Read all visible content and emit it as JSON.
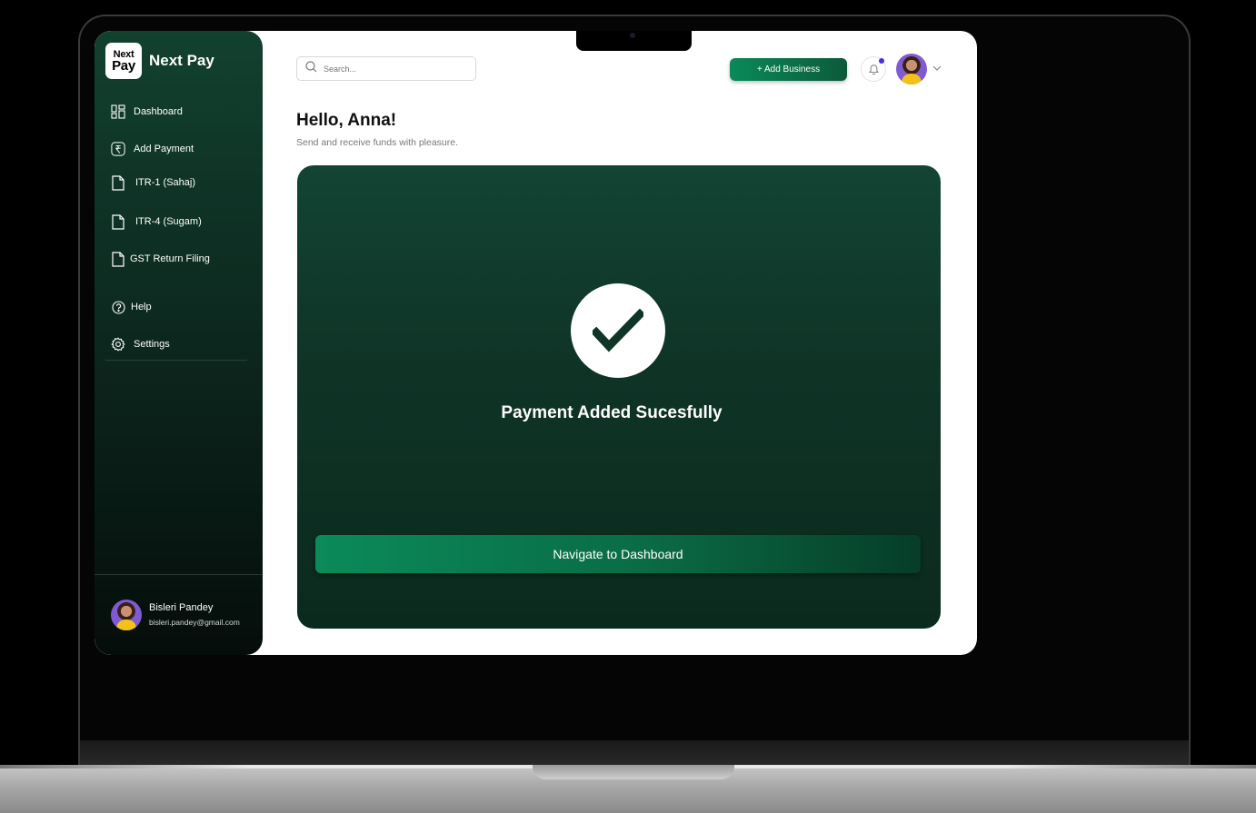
{
  "app": {
    "logo_line1": "Next",
    "logo_line2": "Pay",
    "name": "Next Pay"
  },
  "sidebar": {
    "items": [
      {
        "label": "Dashboard",
        "icon": "dashboard-icon"
      },
      {
        "label": "Add Payment",
        "icon": "rupee-icon"
      },
      {
        "label": "ITR-1 (Sahaj)",
        "icon": "document-icon"
      },
      {
        "label": "ITR-4 (Sugam)",
        "icon": "document-icon"
      },
      {
        "label": "GST Return Filing",
        "icon": "document-icon"
      },
      {
        "label": "Help",
        "icon": "help-icon"
      },
      {
        "label": "Settings",
        "icon": "gear-icon"
      }
    ],
    "user": {
      "name": "Bisleri Pandey",
      "email": "bisleri.pandey@gmail.com"
    }
  },
  "header": {
    "search_placeholder": "Search...",
    "add_business_label": "+ Add Business",
    "notification_badge_color": "#4a2de0"
  },
  "main": {
    "greeting": "Hello, Anna!",
    "subtitle": "Send and receive funds with pleasure.",
    "success_message": "Payment Added Sucesfully",
    "navigate_label": "Navigate to Dashboard"
  },
  "colors": {
    "brand_dark": "#0f3527",
    "accent": "#0a8a58"
  }
}
